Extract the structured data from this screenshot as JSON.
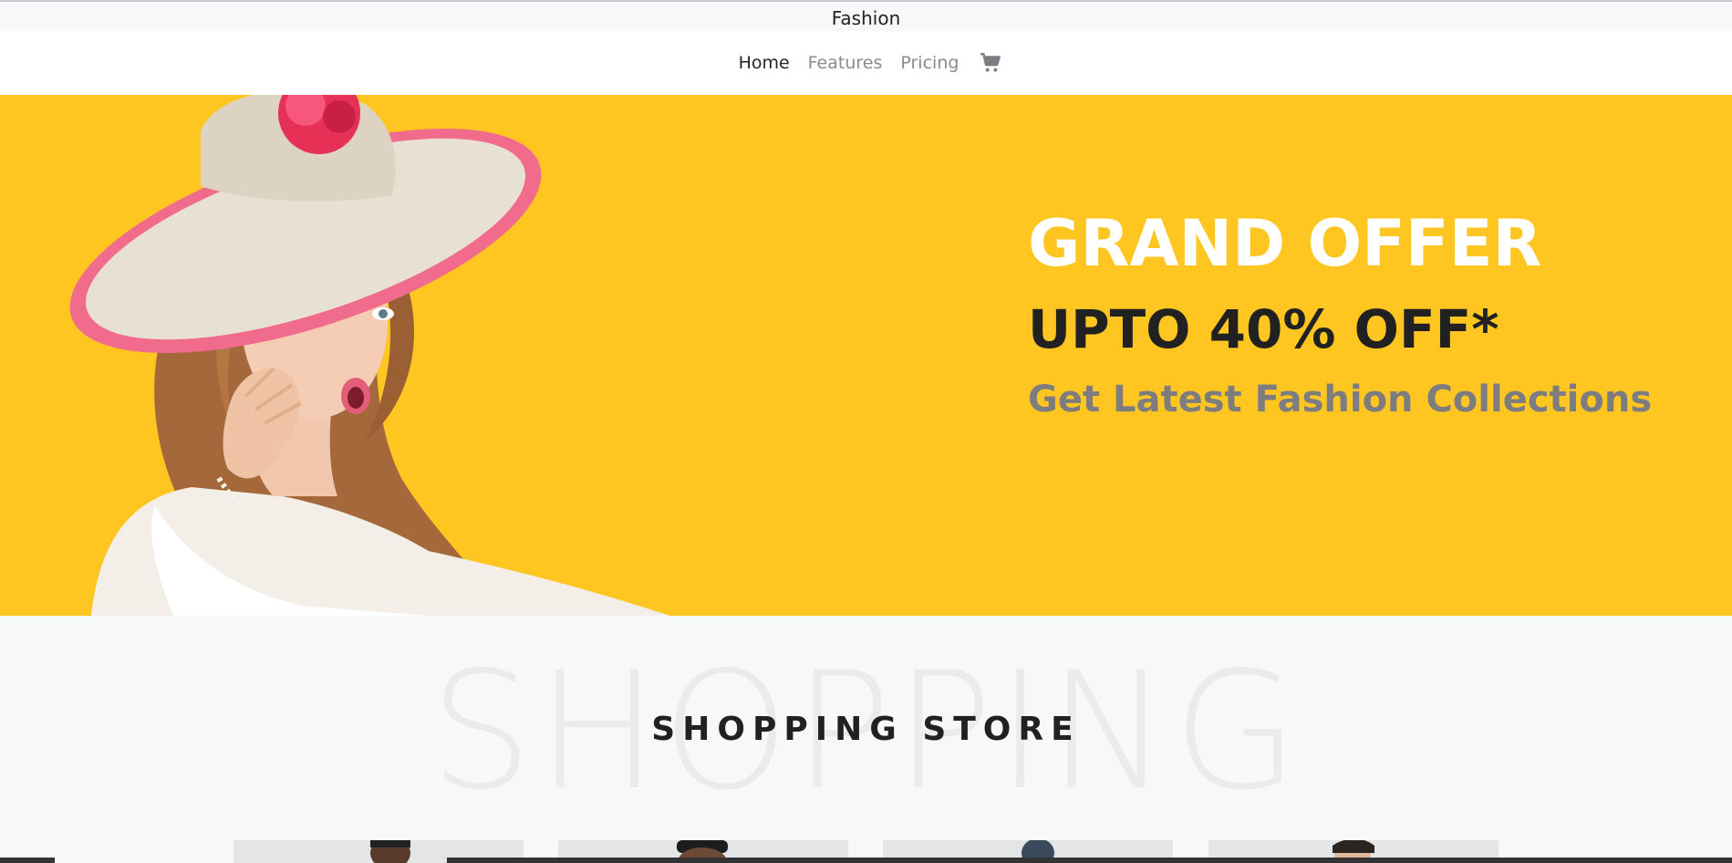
{
  "brand": "Fashion",
  "nav": {
    "items": [
      {
        "label": "Home",
        "active": true
      },
      {
        "label": "Features",
        "active": false
      },
      {
        "label": "Pricing",
        "active": false
      }
    ],
    "cart_icon": "shopping-cart-icon"
  },
  "hero": {
    "title": "GRAND OFFER",
    "subtitle": "UPTO 40% OFF*",
    "tagline": "Get Latest Fashion Collections",
    "background_color": "#ffc622"
  },
  "store": {
    "watermark": "SHOPPING",
    "title": "SHOPPING STORE"
  }
}
